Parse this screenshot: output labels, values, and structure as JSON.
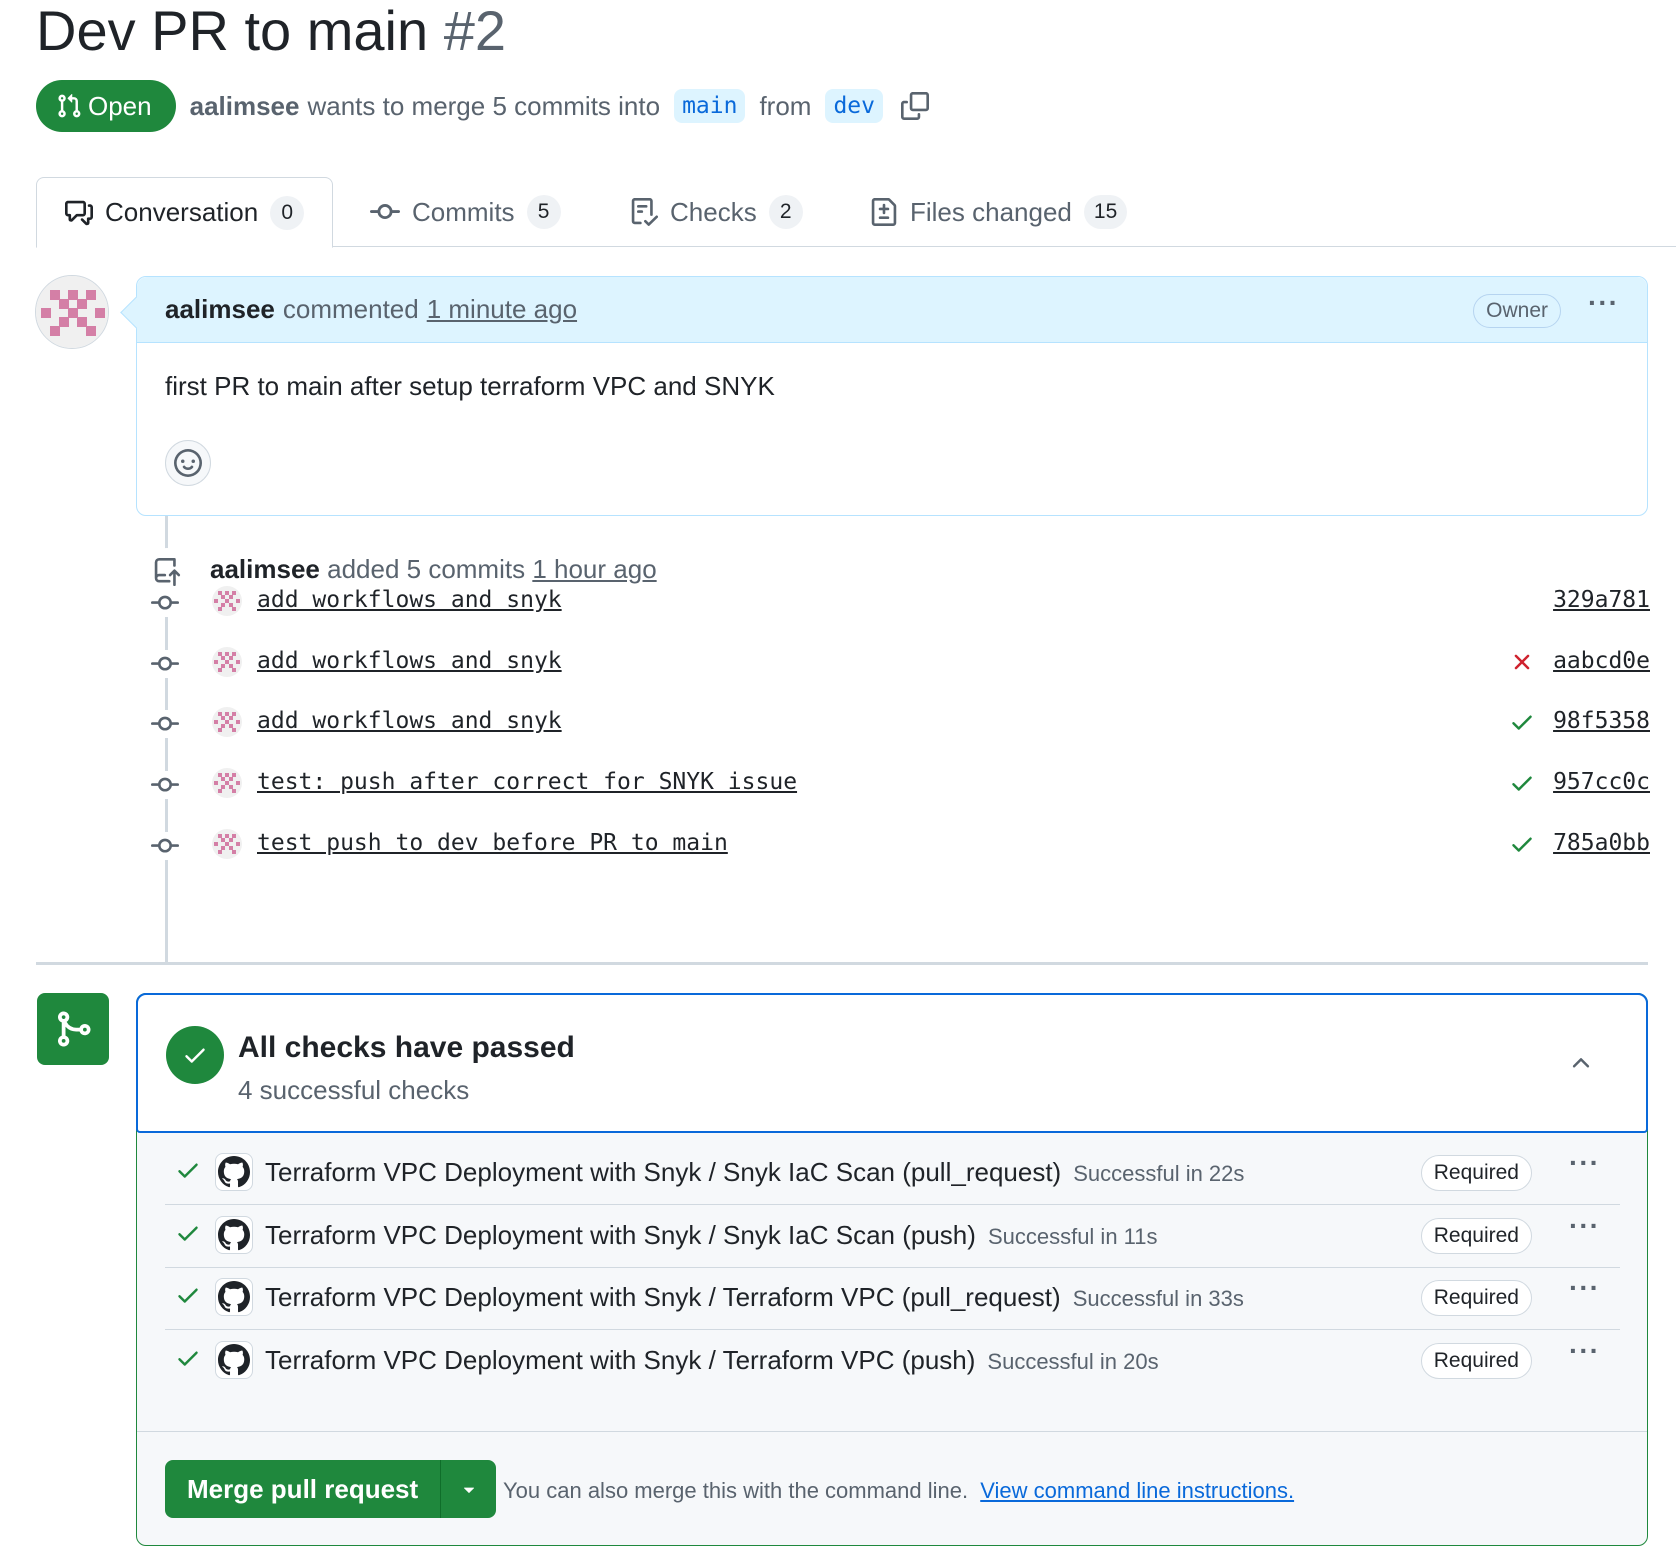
{
  "pr": {
    "title": "Dev PR to main",
    "number": "#2",
    "state": "Open",
    "author": "aalimsee",
    "summary_text": "wants to merge 5 commits into",
    "base_branch": "main",
    "from_text": "from",
    "head_branch": "dev"
  },
  "tabs": [
    {
      "label": "Conversation",
      "count": "0",
      "icon": "comment-discussion-icon"
    },
    {
      "label": "Commits",
      "count": "5",
      "icon": "git-commit-icon"
    },
    {
      "label": "Checks",
      "count": "2",
      "icon": "checklist-icon"
    },
    {
      "label": "Files changed",
      "count": "15",
      "icon": "file-diff-icon"
    }
  ],
  "comment": {
    "author": "aalimsee",
    "action": "commented",
    "time": "1 minute ago",
    "badge": "Owner",
    "body": "first PR to main after setup terraform VPC and SNYK"
  },
  "push_event": {
    "author": "aalimsee",
    "action": "added 5 commits",
    "time": "1 hour ago"
  },
  "commits": [
    {
      "message": "add workflows and snyk",
      "sha": "329a781",
      "status": "none"
    },
    {
      "message": "add workflows and snyk",
      "sha": "aabcd0e",
      "status": "failure"
    },
    {
      "message": "add workflows and snyk",
      "sha": "98f5358",
      "status": "success"
    },
    {
      "message": "test: push after correct for SNYK issue",
      "sha": "957cc0c",
      "status": "success"
    },
    {
      "message": "test push to dev before PR to main",
      "sha": "785a0bb",
      "status": "success"
    }
  ],
  "checks": {
    "title": "All checks have passed",
    "subtitle": "4 successful checks",
    "items": [
      {
        "name": "Terraform VPC Deployment with Snyk / Snyk IaC Scan (pull_request)",
        "duration": "Successful in 22s",
        "badge": "Required"
      },
      {
        "name": "Terraform VPC Deployment with Snyk / Snyk IaC Scan (push)",
        "duration": "Successful in 11s",
        "badge": "Required"
      },
      {
        "name": "Terraform VPC Deployment with Snyk / Terraform VPC (pull_request)",
        "duration": "Successful in 33s",
        "badge": "Required"
      },
      {
        "name": "Terraform VPC Deployment with Snyk / Terraform VPC (push)",
        "duration": "Successful in 20s",
        "badge": "Required"
      }
    ]
  },
  "merge": {
    "button_label": "Merge pull request",
    "hint": "You can also merge this with the command line.",
    "link": "View command line instructions."
  },
  "colors": {
    "success": "#1f883d",
    "danger": "#cf222e",
    "accent": "#0969da",
    "comment_header_bg": "#ddf4ff",
    "identicon": "#d47fa6"
  }
}
